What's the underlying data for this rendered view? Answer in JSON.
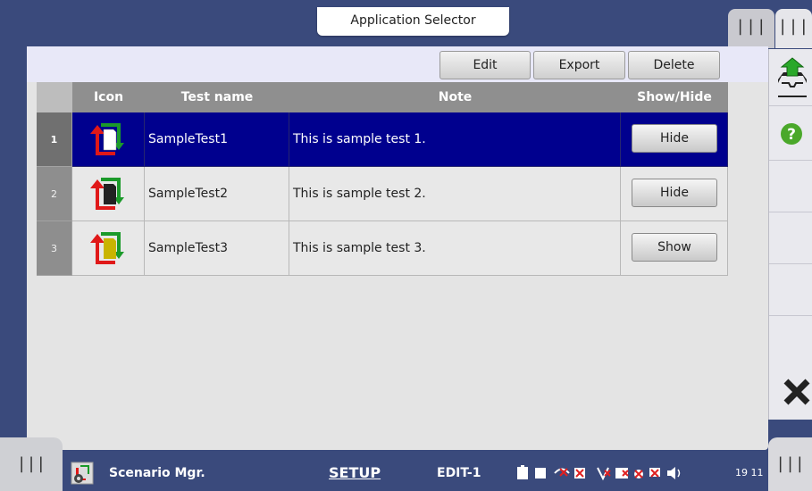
{
  "app_selector": {
    "title": "Application Selector"
  },
  "top_tabs": [
    "|||",
    "|||"
  ],
  "toolbar": {
    "edit_label": "Edit",
    "export_label": "Export",
    "delete_label": "Delete"
  },
  "table": {
    "headers": [
      "Icon",
      "Test name",
      "Note",
      "Show/Hide"
    ],
    "rows": [
      {
        "num": "1",
        "name": "SampleTest1",
        "note": "This is sample test 1.",
        "action": "Hide",
        "doc_color": "#ffffff",
        "selected": true
      },
      {
        "num": "2",
        "name": "SampleTest2",
        "note": "This is sample test 2.",
        "action": "Hide",
        "doc_color": "#222222",
        "selected": false
      },
      {
        "num": "3",
        "name": "SampleTest3",
        "note": "This is sample test 3.",
        "action": "Show",
        "doc_color": "#c9b400",
        "selected": false
      }
    ]
  },
  "sidebar": {
    "icons": [
      "upload-tray-icon",
      "help-icon",
      "close-icon"
    ]
  },
  "bottom": {
    "left_tab": "|||",
    "right_tab": "|||",
    "app_name": "Scenario Mgr.",
    "mode": "SETUP",
    "status": "EDIT-1",
    "clock": "19 11"
  },
  "colors": {
    "selected_row": "#00008e",
    "frame": "#3a4a7c",
    "help": "#4aa82a"
  }
}
